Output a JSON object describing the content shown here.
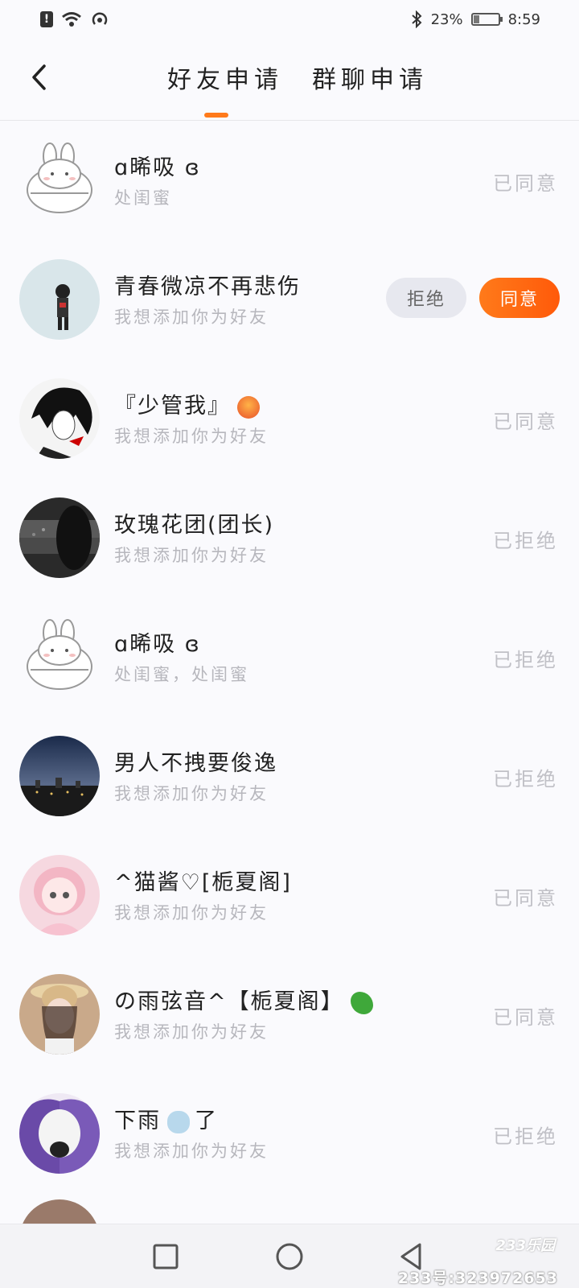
{
  "status_bar": {
    "battery": "23%",
    "time": "8:59"
  },
  "header": {
    "tabs": [
      {
        "label": "好友申请",
        "active": true
      },
      {
        "label": "群聊申请",
        "active": false
      }
    ]
  },
  "requests": [
    {
      "name": "ɑ晞吸 ɞ",
      "message": "处闺蜜",
      "status": "已同意"
    },
    {
      "name": "青春微凉不再悲伤",
      "message": "我想添加你为好友",
      "reject_label": "拒绝",
      "accept_label": "同意"
    },
    {
      "name": "『少管我』",
      "message": "我想添加你为好友",
      "status": "已同意"
    },
    {
      "name": "玫瑰花团(团长)",
      "message": "我想添加你为好友",
      "status": "已拒绝"
    },
    {
      "name": "ɑ晞吸 ɞ",
      "message": "处闺蜜，处闺蜜",
      "status": "已拒绝"
    },
    {
      "name": "男人不拽要俊逸",
      "message": "我想添加你为好友",
      "status": "已拒绝"
    },
    {
      "name": "^猫酱♡[栀夏阁]",
      "message": "我想添加你为好友",
      "status": "已同意"
    },
    {
      "name": "の雨弦音^【栀夏阁】",
      "message": "我想添加你为好友",
      "status": "已同意"
    },
    {
      "name": "下雨",
      "name_suffix": "了",
      "message": "我想添加你为好友",
      "status": "已拒绝"
    }
  ],
  "watermark": {
    "logo": "233乐园",
    "id": "233号:323972653"
  },
  "colors": {
    "accent": "#ff7a1a",
    "muted": "#c0c0c6",
    "reject_bg": "#e7e8ef"
  }
}
